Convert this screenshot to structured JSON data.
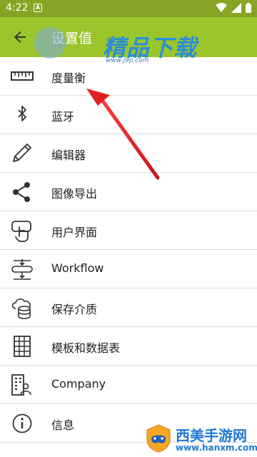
{
  "statusbar": {
    "time": "4:22",
    "notification_letter": "A"
  },
  "appbar": {
    "title": "设置值"
  },
  "watermark_top": {
    "brand": "精品下载",
    "url": "www.j9p.com"
  },
  "menu": [
    {
      "label": "度量衡",
      "icon": "ruler-icon"
    },
    {
      "label": "蓝牙",
      "icon": "bluetooth-icon"
    },
    {
      "label": "编辑器",
      "icon": "pencil-icon"
    },
    {
      "label": "图像导出",
      "icon": "share-icon"
    },
    {
      "label": "用户界面",
      "icon": "touch-hand-icon"
    },
    {
      "label": "Workflow",
      "icon": "workflow-icon"
    },
    {
      "label": "保存介质",
      "icon": "cloud-storage-icon"
    },
    {
      "label": "模板和数据表",
      "icon": "grid-table-icon"
    },
    {
      "label": "Company",
      "icon": "company-icon"
    },
    {
      "label": "信息",
      "icon": "info-icon"
    }
  ],
  "watermark_bottom": {
    "name": "西美手游网",
    "url": "www.hanxm.com"
  },
  "colors": {
    "statusbar": "#86a524",
    "appbar": "#9ac52b",
    "annotation_arrow": "#e02020"
  }
}
